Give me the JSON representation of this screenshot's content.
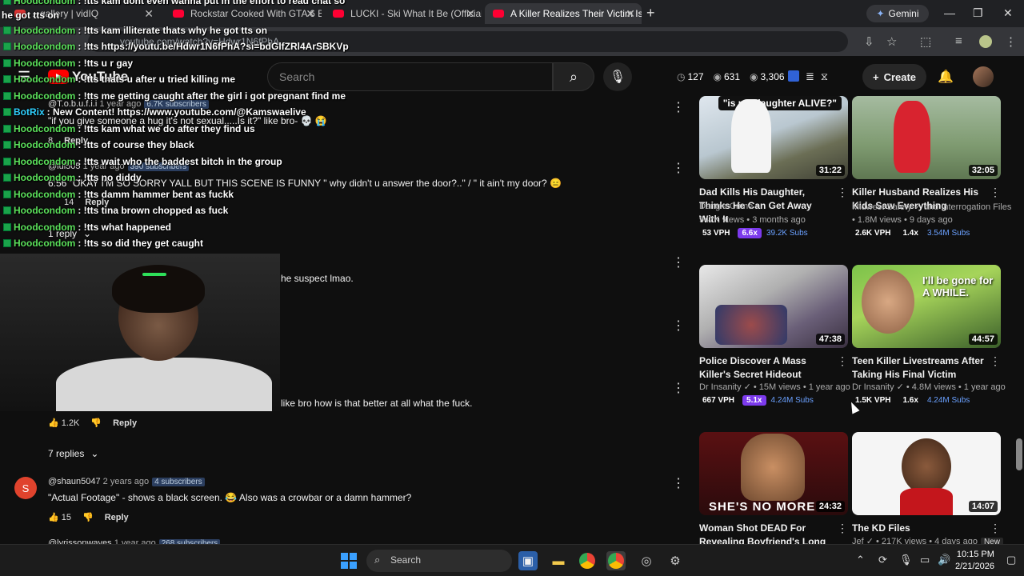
{
  "browser": {
    "tabs": [
      {
        "label": "...gallery | vidIQ"
      },
      {
        "label": "Rockstar Cooked With GTA 6 Br"
      },
      {
        "label": "LUCKI - Ski What It Be (Official"
      },
      {
        "label": "A Killer Realizes Their Victim Is"
      }
    ],
    "new_tab": "+",
    "gemini_label": "Gemini",
    "url": "youtube.com/watch?v=Hdwr1N6fPhA"
  },
  "youtube": {
    "logo_text": "YouTube",
    "filter_label": "Filter",
    "search_placeholder": "Search",
    "stats": {
      "views": "127",
      "eyes": "631",
      "visits": "3,306"
    },
    "create_label": "Create"
  },
  "chat": [
    {
      "user": "Hoodcondom",
      "msg": ": !tts kam dont even wanna put in the effort to read chat so"
    },
    {
      "user": "he got tts on",
      "msg": ""
    },
    {
      "user": "Hoodcondom",
      "msg": ": !tts kam illiterate thats why he got tts on"
    },
    {
      "user": "Hoodcondom",
      "msg": ": !tts https://youtu.be/Hdwr1N6fPhA?si=bdGlfZRl4ArSBKVp"
    },
    {
      "user": "Hoodcondom",
      "msg": ": !tts u r gay"
    },
    {
      "user": "Hoodcondom",
      "msg": ": !tts thats u after u tried killing me"
    },
    {
      "user": "Hoodcondom",
      "msg": ": !tts me getting caught after the girl i got pregnant find me"
    },
    {
      "user": "BotRix",
      "msg": ": New Content! https://www.youtube.com/@Kamswaelive"
    },
    {
      "user": "Hoodcondom",
      "msg": ": !tts kam what we do after they find us"
    },
    {
      "user": "Hoodcondom",
      "msg": ": !tts of course they black"
    },
    {
      "user": "Hoodcondom",
      "msg": ": !tts wait who the baddest bitch in the group"
    },
    {
      "user": "Hoodcondom",
      "msg": ": !tts no diddy"
    },
    {
      "user": "Hoodcondom",
      "msg": ": !tts damm hammer bent as fuckk"
    },
    {
      "user": "Hoodcondom",
      "msg": ": !tts tina brown chopped as fuck"
    },
    {
      "user": "Hoodcondom",
      "msg": ": !tts what happened"
    },
    {
      "user": "Hoodcondom",
      "msg": ": !tts so did they get caught"
    }
  ],
  "comments": {
    "c1": {
      "handle": "@T.o.b.u.f.i.i",
      "time": "1 year ago",
      "subs": "6.7K subscribers",
      "text": "\"if you give someone a hug it's not sexual.....Is it?\" like bro- 💀 😭",
      "likes": "8",
      "reply": "Reply"
    },
    "c2": {
      "handle": "@lul505",
      "time": "1 year ago",
      "subs": "390 subscribers",
      "text": "6:56 \"OKAY I'M SO SORRY YALL BUT THIS SCENE IS FUNNY \" why didn't u answer the door?..\" / \" it ain't my door? 😑",
      "likes": "14",
      "reply": "Reply",
      "replies": "1 reply"
    },
    "c3_fragment": "he suspect lmao.",
    "c4_fragment": "like bro how is that better at all what the fuck.",
    "c4_likes": "1.2K",
    "c4_reply": "Reply",
    "c4_replies": "7 replies",
    "c5": {
      "avatar": "S",
      "handle": "@shaun5047",
      "time": "2 years ago",
      "subs": "4 subscribers",
      "text": "\"Actual Footage\" - shows a black screen. 😂 Also was a crowbar or a damn hammer?",
      "likes": "15",
      "reply": "Reply"
    },
    "c6": {
      "handle": "@lyrissonwaves",
      "time": "1 year ago",
      "subs": "268 subscribers"
    }
  },
  "videos": [
    {
      "title": "Dad Kills His Daughter, Thinks He Can Get Away With It",
      "channel": "Dangle Crime •",
      "meta": "947K views • 3 months ago",
      "duration": "31:22",
      "vph": "53 VPH",
      "mult": "6.6x",
      "subs": "39.2K Subs",
      "thumb_text": "\"is my daughter ALIVE?\""
    },
    {
      "title": "Killer Husband Realizes His Kids Saw Everything",
      "channel": "Midwest Safety ✓ and Interrogation Files ✓",
      "meta": "• 1.8M views • 9 days ago",
      "duration": "32:05",
      "vph": "2.6K VPH",
      "mult": "1.4x",
      "subs": "3.54M Subs"
    },
    {
      "title": "Police Discover A Mass Killer's Secret Hideout",
      "channel": "Dr Insanity ✓ • 15M views • 1 year ago",
      "meta": "",
      "duration": "47:38",
      "vph": "667 VPH",
      "mult": "5.1x",
      "subs": "4.24M Subs"
    },
    {
      "title": "Teen Killer Livestreams After Taking His Final Victim",
      "channel": "Dr Insanity ✓ • 4.8M views • 1 year ago",
      "meta": "",
      "duration": "44:57",
      "vph": "1.5K VPH",
      "mult": "1.6x",
      "subs": "4.24M Subs",
      "thumb_text": "I'll be gone for A WHILE."
    },
    {
      "title": "Woman Shot DEAD For Revealing Boyfriend's Long ...",
      "channel": "",
      "meta": "",
      "duration": "24:32",
      "thumb_text": "SHE'S NO MORE"
    },
    {
      "title": "The KD Files",
      "channel": "Jef ✓ • 217K views • 4 days ago",
      "new_tag": "New",
      "meta": "",
      "duration": "14:07"
    }
  ],
  "taskbar": {
    "search_label": "Search",
    "time": "10:15 PM",
    "date": "2/21/2026"
  }
}
